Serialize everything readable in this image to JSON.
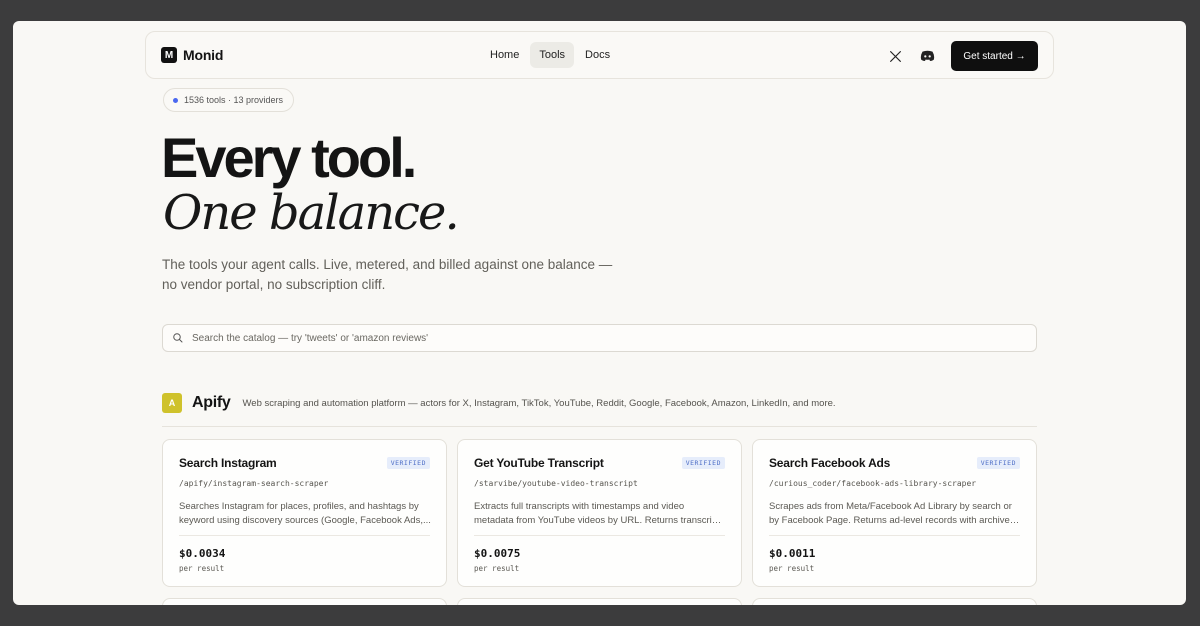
{
  "brand": {
    "mark": "M",
    "name": "Monid"
  },
  "nav": {
    "links": [
      {
        "label": "Home",
        "active": false
      },
      {
        "label": "Tools",
        "active": true
      },
      {
        "label": "Docs",
        "active": false
      }
    ],
    "social_icons": [
      "x-icon",
      "discord-icon"
    ],
    "cta_label": "Get started →"
  },
  "stats_pill": "1536 tools · 13 providers",
  "hero": {
    "line1": "Every tool.",
    "line2": "One balance.",
    "lede": "The tools your agent calls. Live, metered, and billed against one balance — no vendor portal, no subscription cliff."
  },
  "search": {
    "placeholder": "Search the catalog — try 'tweets' or 'amazon reviews'",
    "value": ""
  },
  "provider": {
    "badge": "A",
    "name": "Apify",
    "description": "Web scraping and automation platform — actors for X, Instagram, TikTok, YouTube, Reddit, Google, Facebook, Amazon, LinkedIn, and more."
  },
  "cards": [
    {
      "title": "Search Instagram",
      "badge": "VERIFIED",
      "path": "/apify/instagram-search-scraper",
      "description": "Searches Instagram for places, profiles, and hashtags by keyword using discovery sources (Google, Facebook Ads,...",
      "price": "$0.0034",
      "unit": "per result"
    },
    {
      "title": "Get YouTube Transcript",
      "badge": "VERIFIED",
      "path": "/starvibe/youtube-video-transcript",
      "description": "Extracts full transcripts with timestamps and video metadata from YouTube videos by URL. Returns transcript text with...",
      "price": "$0.0075",
      "unit": "per result"
    },
    {
      "title": "Search Facebook Ads",
      "badge": "VERIFIED",
      "path": "/curious_coder/facebook-ads-library-scraper",
      "description": "Scrapes ads from Meta/Facebook Ad Library by search or by Facebook Page. Returns ad-level records with archive and...",
      "price": "$0.0011",
      "unit": "per result"
    }
  ],
  "colors": {
    "page_bg": "#f9f8f5",
    "frame_bg": "#3c3c3d",
    "cta_bg": "#0f0f0f",
    "badge_bg": "#e6edfb",
    "badge_text": "#4f6fc7",
    "provider_badge": "#cfc22b",
    "pill_dot": "#4a68f0"
  }
}
